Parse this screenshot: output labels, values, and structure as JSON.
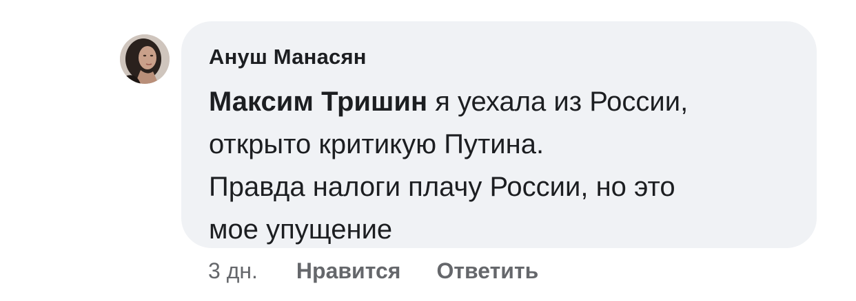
{
  "comment": {
    "author": "Ануш Манасян",
    "mention": "Максим Тришин",
    "line1_rest": " я уехала из России,",
    "line2": "открыто критикую Путина.",
    "line3": "Правда налоги плачу России, но это",
    "line4": "мое упущение",
    "avatar_icon": "user-photo-icon"
  },
  "actions": {
    "timestamp": "3 дн.",
    "like_label": "Нравится",
    "reply_label": "Ответить"
  },
  "colors": {
    "bubble_bg": "#f0f2f5",
    "text": "#1c1e21",
    "secondary": "#65676b"
  }
}
